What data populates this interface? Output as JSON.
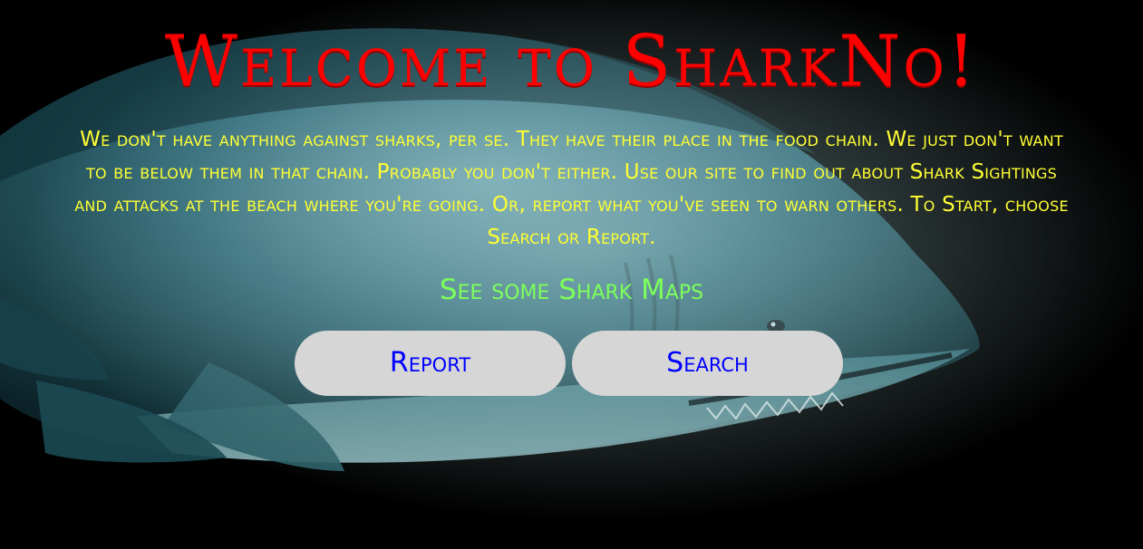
{
  "hero": {
    "title": "Welcome to SharkNo!",
    "intro": "We don't have anything against sharks, per se. They have their place in the food chain. We just don't want to be below them in that chain. Probably you don't either. Use our site to find out about Shark Sightings and attacks at the beach where you're going. Or, report what you've seen to warn others. To Start, choose Search or Report.",
    "maps_link": "See some Shark Maps"
  },
  "actions": {
    "report_label": "Report",
    "search_label": "Search"
  },
  "colors": {
    "background": "#000000",
    "title": "#ff0000",
    "intro_text": "#ffff33",
    "link": "#7cff5a",
    "button_bg": "#d6d6d6",
    "button_text": "#0000ff"
  },
  "background_image": "shark-photo"
}
